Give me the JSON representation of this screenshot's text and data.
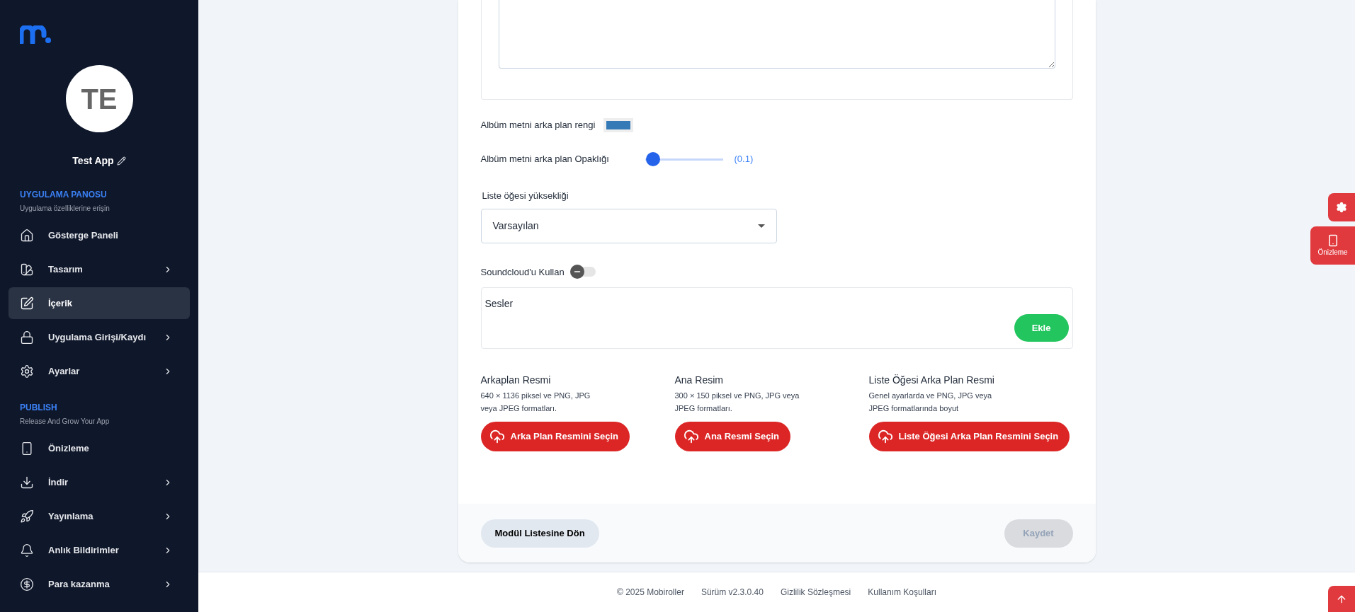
{
  "sidebar": {
    "app_avatar": "TE",
    "app_name": "Test App",
    "sections": [
      {
        "title": "UYGULAMA PANOSU",
        "subtitle": "Uygulama özelliklerine erişin",
        "items": [
          {
            "label": "Gösterge Paneli",
            "selected": false,
            "has_submenu": false
          },
          {
            "label": "Tasarım",
            "selected": false,
            "has_submenu": true
          },
          {
            "label": "İçerik",
            "selected": true,
            "has_submenu": false
          },
          {
            "label": "Uygulama Girişi/Kaydı",
            "selected": false,
            "has_submenu": true
          },
          {
            "label": "Ayarlar",
            "selected": false,
            "has_submenu": true
          }
        ]
      },
      {
        "title": "PUBLISH",
        "subtitle": "Release And Grow Your App",
        "items": [
          {
            "label": "Önizleme",
            "selected": false,
            "has_submenu": false
          },
          {
            "label": "İndir",
            "selected": false,
            "has_submenu": true
          },
          {
            "label": "Yayınlama",
            "selected": false,
            "has_submenu": true
          },
          {
            "label": "Anlık Bildirimler",
            "selected": false,
            "has_submenu": true
          },
          {
            "label": "Para kazanma",
            "selected": false,
            "has_submenu": true
          }
        ]
      }
    ]
  },
  "form": {
    "color_label": "Albüm metni arka plan rengi",
    "color": "#337ab7",
    "opacity_label": "Albüm metni arka plan Opaklığı",
    "opacity": {
      "level": 0.1,
      "reading": "(0.1)"
    },
    "height_label": "Liste öğesi yüksekliği",
    "height_value": "Varsayılan",
    "soundcloud": {
      "label": "Soundcloud'u Kullan",
      "on": false
    },
    "sounds": {
      "title": "Sesler",
      "add_button": "Ekle"
    },
    "uploads": [
      {
        "title": "Arkaplan Resmi",
        "hint": "640 × 1136 piksel ve PNG, JPG veya JPEG formatları.",
        "button": "Arka Plan Resmini Seçin"
      },
      {
        "title": "Ana Resim",
        "hint": "300 × 150 piksel ve PNG, JPG veya JPEG formatları.",
        "button": "Ana Resmi Seçin"
      },
      {
        "title": "Liste Öğesi Arka Plan Resmi",
        "hint": "Genel ayarlarda ve PNG, JPG veya JPEG formatlarında boyut",
        "button": "Liste Öğesi Arka Plan Resmini Seçin"
      }
    ],
    "back_button": "Modül Listesine Dön",
    "save_button": {
      "label": "Kaydet",
      "disabled": true
    }
  },
  "floating": {
    "preview_label": "Önizleme"
  },
  "footer": [
    "© 2025 Mobiroller",
    "Sürüm v2.3.0.40",
    "Gizlilik Sözleşmesi",
    "Kullanım Koşulları"
  ]
}
